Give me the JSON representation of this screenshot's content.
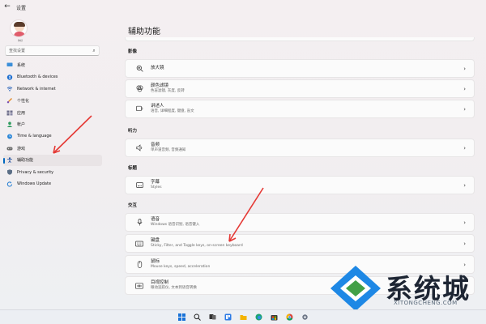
{
  "window": {
    "title": "设置"
  },
  "profile": {
    "name": "你好"
  },
  "search": {
    "placeholder": "查找设置"
  },
  "sidebar": {
    "items": [
      {
        "label": "系统",
        "active": false
      },
      {
        "label": "Bluetooth & devices",
        "active": false
      },
      {
        "label": "Network & internet",
        "active": false
      },
      {
        "label": "个性化",
        "active": false
      },
      {
        "label": "应用",
        "active": false
      },
      {
        "label": "帐户",
        "active": false
      },
      {
        "label": "Time & language",
        "active": false
      },
      {
        "label": "游戏",
        "active": false
      },
      {
        "label": "辅助功能",
        "active": true
      },
      {
        "label": "Privacy & security",
        "active": false
      },
      {
        "label": "Windows Update",
        "active": false
      }
    ]
  },
  "main": {
    "title": "辅助功能",
    "sections": [
      {
        "label": "影像",
        "cards": [
          {
            "title": "放大镜",
            "subtitle": ""
          },
          {
            "title": "颜色滤镜",
            "subtitle": "色盲滤镜, 灰度, 反转"
          },
          {
            "title": "讲述人",
            "subtitle": "语音, 详细程度, 键盘, 盲文"
          }
        ]
      },
      {
        "label": "听力",
        "cards": [
          {
            "title": "音频",
            "subtitle": "单声道音频, 音频通知"
          }
        ]
      },
      {
        "label": "标题",
        "cards": [
          {
            "title": "字幕",
            "subtitle": "Styles"
          }
        ]
      },
      {
        "label": "交互",
        "cards": [
          {
            "title": "语音",
            "subtitle": "Windows 语音识别, 语音键入"
          },
          {
            "title": "键盘",
            "subtitle": "Sticky, Filter, and Toggle keys, on-screen keyboard"
          },
          {
            "title": "鼠标",
            "subtitle": "Mouse keys, speed, acceleration"
          },
          {
            "title": "目视控制",
            "subtitle": "眼动追踪仪, 文本到语音转换"
          }
        ]
      }
    ]
  },
  "watermark": {
    "text": "系统城",
    "sub": "XITONGCHENG.COM"
  },
  "colors": {
    "accent": "#0067c0",
    "arrow": "#e53935"
  }
}
